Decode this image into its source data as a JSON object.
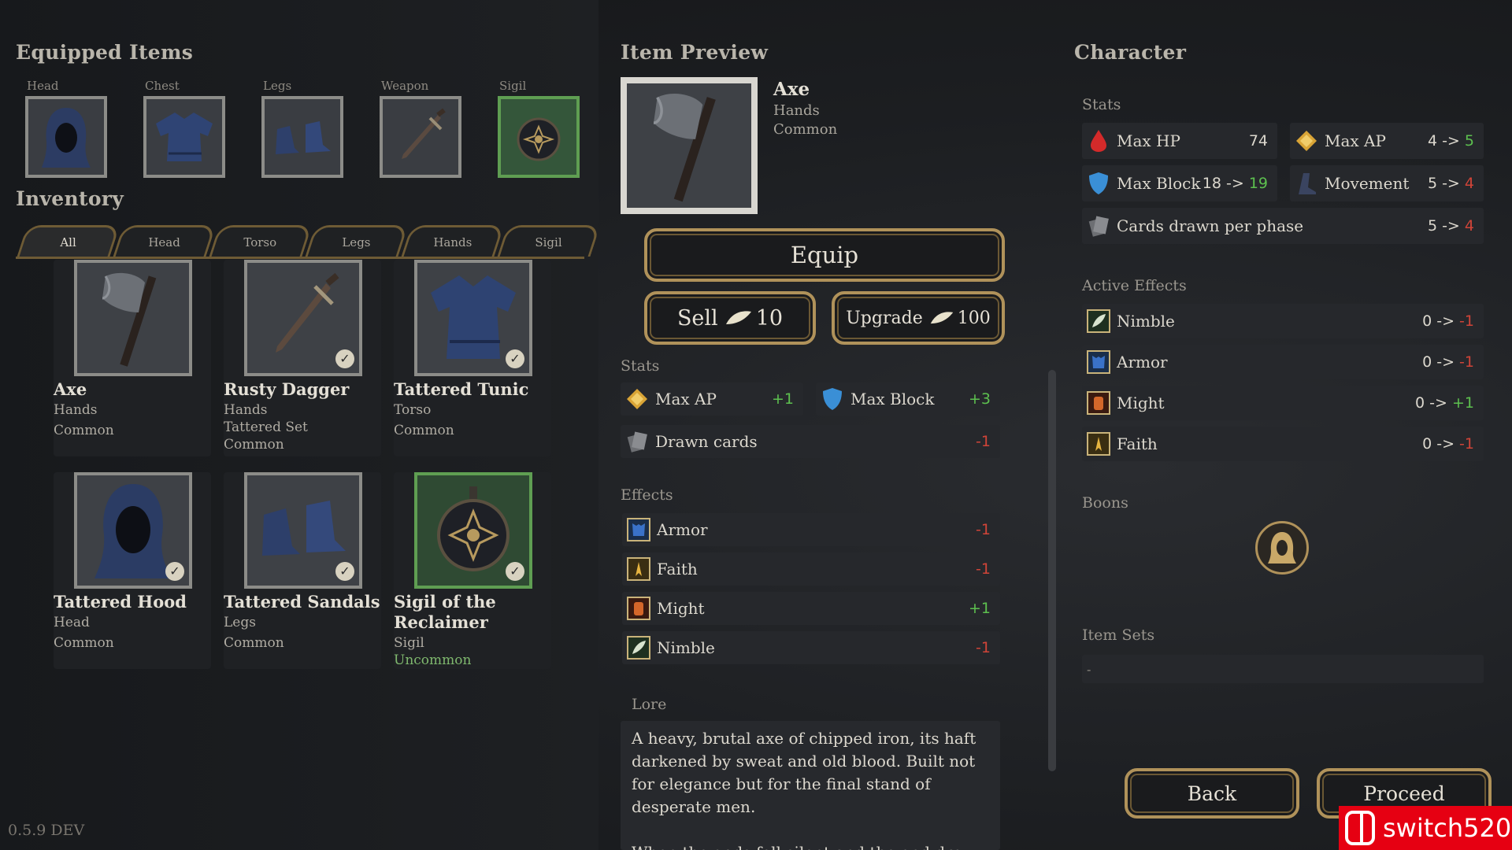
{
  "equipped": {
    "title": "Equipped Items",
    "slots": [
      {
        "label": "Head"
      },
      {
        "label": "Chest"
      },
      {
        "label": "Legs"
      },
      {
        "label": "Weapon"
      },
      {
        "label": "Sigil"
      }
    ]
  },
  "inventory": {
    "title": "Inventory",
    "tabs": [
      "All",
      "Head",
      "Torso",
      "Legs",
      "Hands",
      "Sigil"
    ],
    "items": [
      {
        "name": "Axe",
        "slot": "Hands",
        "set": "",
        "rarity": "Common",
        "equipped": false
      },
      {
        "name": "Rusty Dagger",
        "slot": "Hands",
        "set": "Tattered Set",
        "rarity": "Common",
        "equipped": true
      },
      {
        "name": "Tattered Tunic",
        "slot": "Torso",
        "set": "",
        "rarity": "Common",
        "equipped": true
      },
      {
        "name": "Tattered Hood",
        "slot": "Head",
        "set": "",
        "rarity": "Common",
        "equipped": true
      },
      {
        "name": "Tattered Sandals",
        "slot": "Legs",
        "set": "",
        "rarity": "Common",
        "equipped": true
      },
      {
        "name": "Sigil of the Reclaimer",
        "slot": "Sigil",
        "set": "",
        "rarity": "Uncommon",
        "equipped": true
      }
    ]
  },
  "preview": {
    "title": "Item Preview",
    "name": "Axe",
    "slot": "Hands",
    "rarity": "Common",
    "equip_label": "Equip",
    "sell_label": "Sell",
    "sell_price": "10",
    "upgrade_label": "Upgrade",
    "upgrade_price": "100",
    "stats_title": "Stats",
    "stats": [
      {
        "name": "Max AP",
        "value": "+1",
        "icon": "ap-diamond-icon"
      },
      {
        "name": "Max Block",
        "value": "+3",
        "icon": "shield-icon"
      },
      {
        "name": "Drawn cards",
        "value": "-1",
        "icon": "cards-icon"
      }
    ],
    "effects_title": "Effects",
    "effects": [
      {
        "name": "Armor",
        "value": "-1",
        "icon": "armor-icon"
      },
      {
        "name": "Faith",
        "value": "-1",
        "icon": "faith-icon"
      },
      {
        "name": "Might",
        "value": "+1",
        "icon": "might-icon"
      },
      {
        "name": "Nimble",
        "value": "-1",
        "icon": "nimble-icon"
      }
    ],
    "lore_title": "Lore",
    "lore": "A heavy, brutal axe of chipped iron, its haft darkened by sweat and old blood. Built not for elegance but for the final stand of desperate men.",
    "lore2": "When the gods fell silent and the end drew"
  },
  "character": {
    "title": "Character",
    "stats_title": "Stats",
    "stats": [
      {
        "name": "Max HP",
        "from": "74",
        "to": "",
        "icon": "blood-drop-icon"
      },
      {
        "name": "Max AP",
        "from": "4 ->",
        "to": "5",
        "dir": "pos",
        "icon": "ap-diamond-icon"
      },
      {
        "name": "Max Block",
        "from": "18 ->",
        "to": "19",
        "dir": "pos",
        "icon": "shield-icon"
      },
      {
        "name": "Movement",
        "from": "5 ->",
        "to": "4",
        "dir": "neg",
        "icon": "boot-icon"
      },
      {
        "name": "Cards drawn per phase",
        "from": "5 ->",
        "to": "4",
        "dir": "neg",
        "icon": "cards-icon"
      }
    ],
    "effects_title": "Active Effects",
    "effects": [
      {
        "name": "Nimble",
        "from": "0 ->",
        "to": "-1",
        "dir": "neg",
        "icon": "nimble-icon"
      },
      {
        "name": "Armor",
        "from": "0 ->",
        "to": "-1",
        "dir": "neg",
        "icon": "armor-icon"
      },
      {
        "name": "Might",
        "from": "0 ->",
        "to": "+1",
        "dir": "pos",
        "icon": "might-icon"
      },
      {
        "name": "Faith",
        "from": "0 ->",
        "to": "-1",
        "dir": "neg",
        "icon": "faith-icon"
      }
    ],
    "boons_title": "Boons",
    "item_sets_title": "Item Sets",
    "item_sets_value": "-",
    "back_label": "Back",
    "proceed_label": "Proceed"
  },
  "version": "0.5.9 DEV",
  "watermark": "switch520",
  "colors": {
    "positive": "#5dc04f",
    "negative": "#d04438",
    "gold_frame": "#b0925a",
    "uncommon": "#7fb86e"
  }
}
